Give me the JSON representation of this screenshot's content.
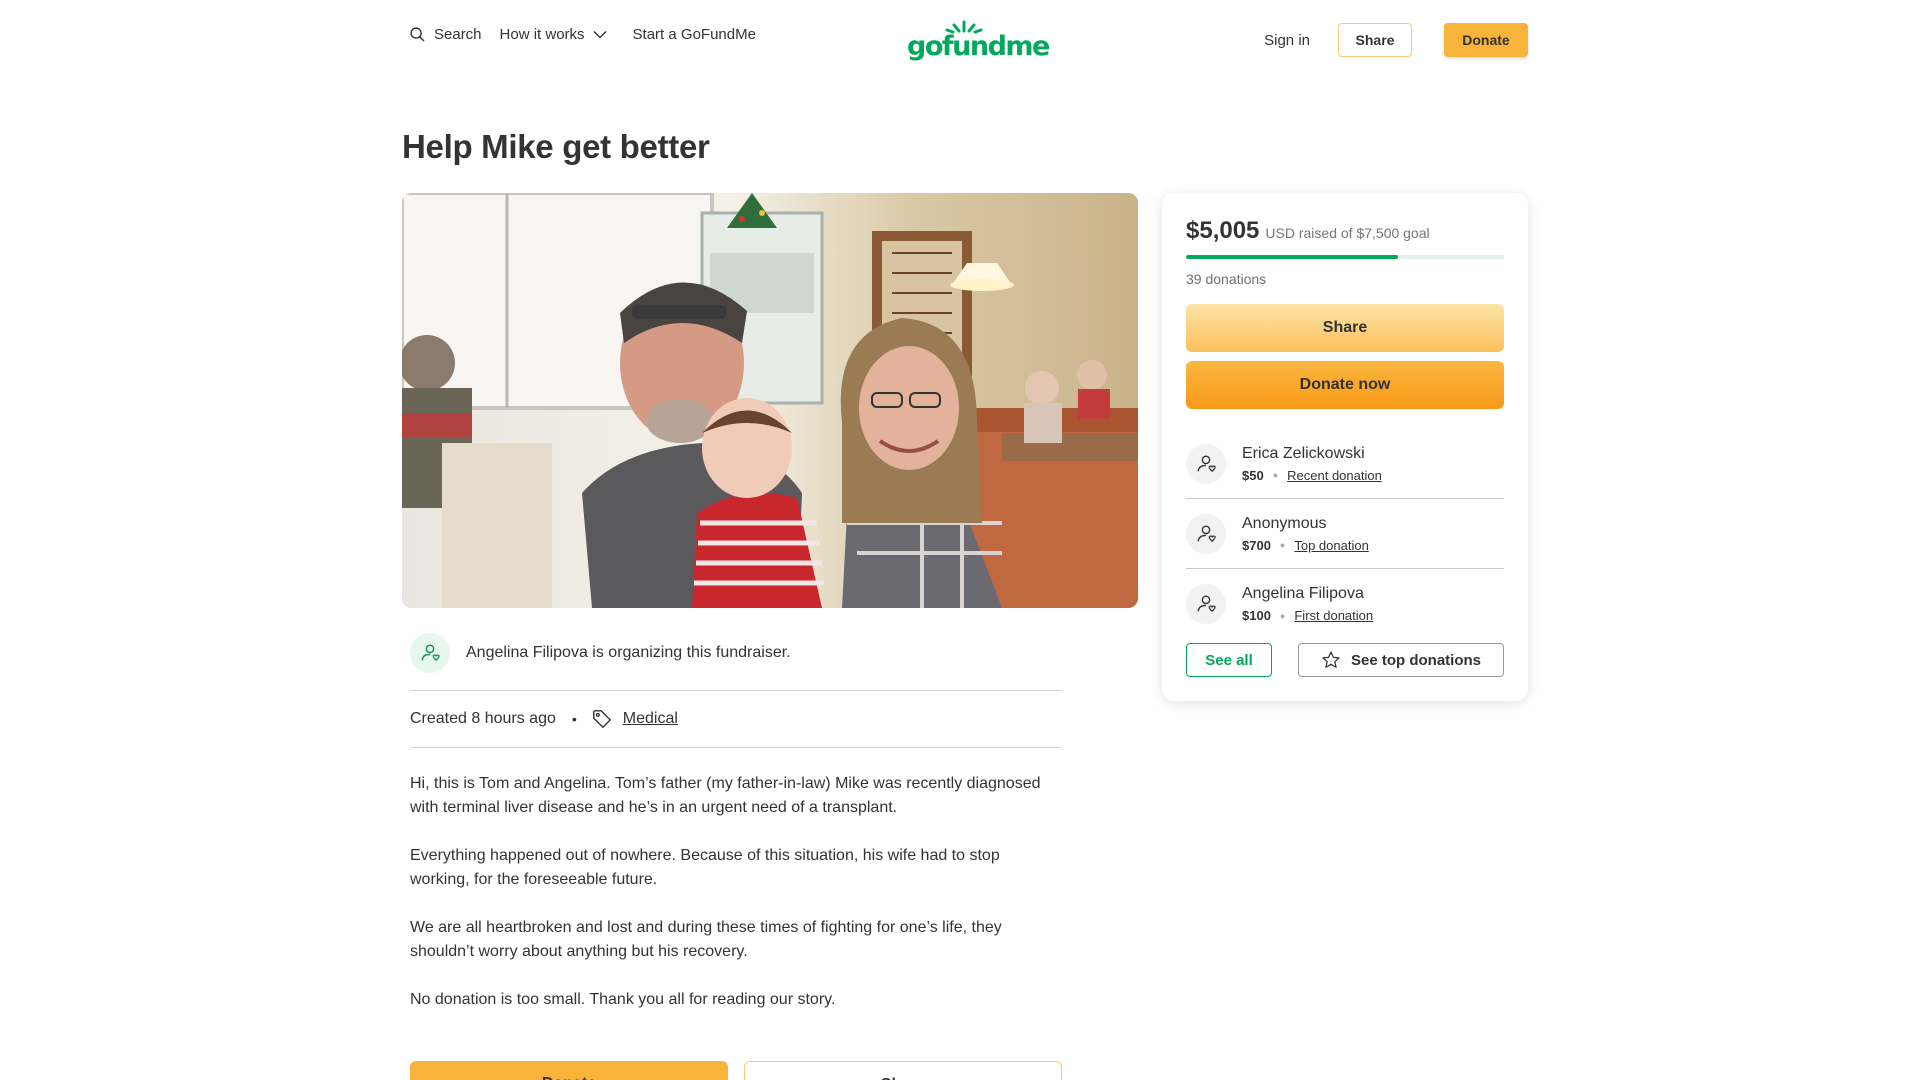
{
  "nav": {
    "search_label": "Search",
    "how_label": "How it works",
    "start_label": "Start a GoFundMe",
    "logo_text": "gofundme",
    "signin_label": "Sign in",
    "share_label": "Share",
    "donate_label": "Donate"
  },
  "campaign": {
    "title": "Help Mike get better",
    "organizer_text": "Angelina Filipova is organizing this fundraiser.",
    "created": "Created 8 hours ago",
    "category": "Medical",
    "story": [
      "Hi, this is Tom and Angelina. Tom’s father (my father-in-law) Mike was recently diagnosed with terminal liver disease and he’s in an urgent need of a transplant.",
      "Everything happened out of nowhere. Because of this situation, his wife had to stop working, for the foreseeable future.",
      "We are all heartbroken and lost and during these times of fighting for one’s life, they shouldn’t worry about anything but his recovery.",
      "No donation is too small. Thank you all for reading our story."
    ],
    "bottom_donate_label": "Donate",
    "bottom_share_label": "Share"
  },
  "card": {
    "raised_amount": "$5,005",
    "raised_text": "USD raised of $7,500 goal",
    "progress_percent": 66.7,
    "donations_count": "39 donations",
    "share_label": "Share",
    "donate_label": "Donate now",
    "donors": [
      {
        "name": "Erica Zelickowski",
        "amount": "$50",
        "tag": "Recent donation"
      },
      {
        "name": "Anonymous",
        "amount": "$700",
        "tag": "Top donation"
      },
      {
        "name": "Angelina Filipova",
        "amount": "$100",
        "tag": "First donation"
      }
    ],
    "see_all_label": "See all",
    "see_top_label": "See top donations"
  },
  "colors": {
    "brand_green": "#02a95c",
    "donate_orange": "#f8b33a"
  },
  "icons": [
    "search-icon",
    "chevron-down-icon",
    "user-heart-icon",
    "tag-icon",
    "star-icon"
  ]
}
